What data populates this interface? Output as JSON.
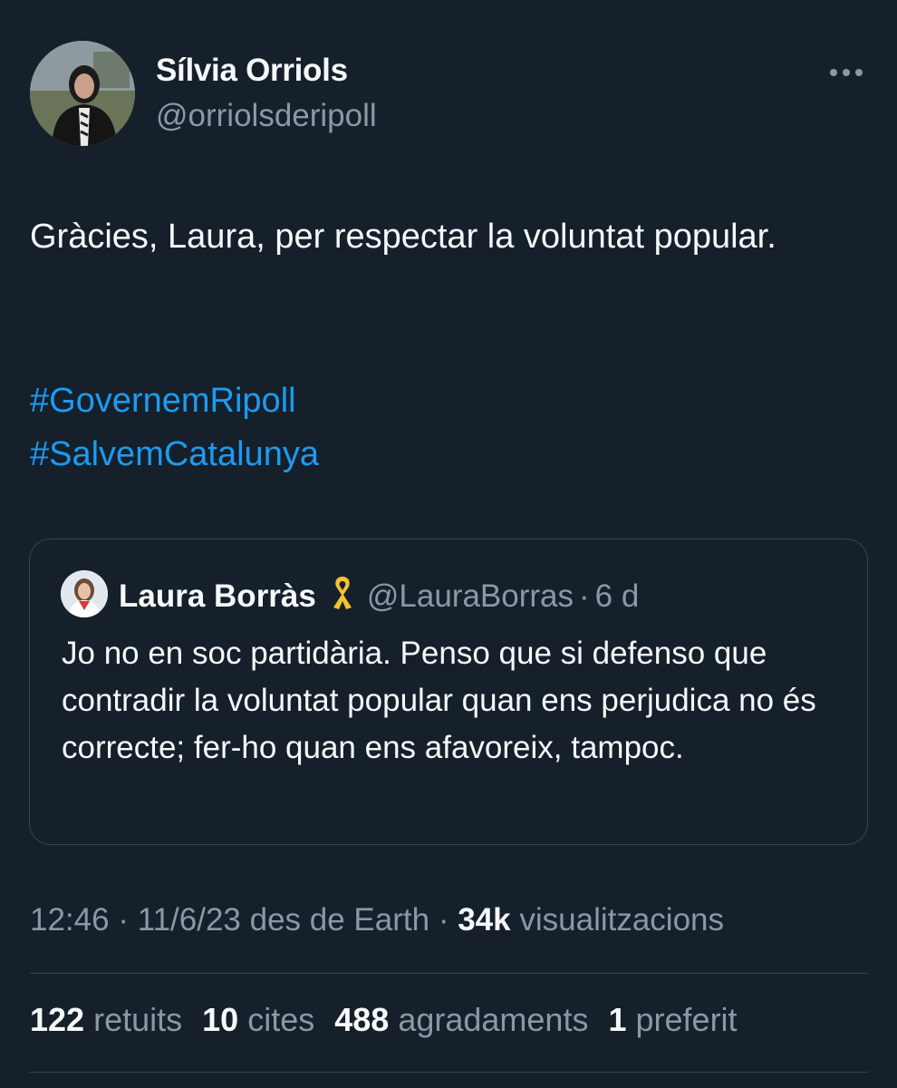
{
  "author": {
    "name": "Sílvia Orriols",
    "handle": "@orriolsderipoll"
  },
  "tweet": {
    "text": "Gràcies, Laura, per respectar la voluntat popular.",
    "hashtags": [
      "#GovernemRipoll",
      "#SalvemCatalunya"
    ]
  },
  "quoted_tweet": {
    "name": "Laura Borràs",
    "name_emoji": "yellow-ribbon-icon",
    "handle": "@LauraBorras",
    "separator": "·",
    "time": "6 d",
    "text": "Jo no en soc partidària. Penso que si defenso que contradir la voluntat popular quan ens perjudica no és correcte; fer-ho quan ens afavoreix, tampoc."
  },
  "meta": {
    "time": "12:46",
    "sep1": "·",
    "date_source": "11/6/23 des de Earth",
    "sep2": "·",
    "views": "34k",
    "views_label": "visualitzacions"
  },
  "stats": {
    "retweets": "122",
    "retweets_label": "retuits",
    "quotes": "10",
    "quotes_label": "cites",
    "likes": "488",
    "likes_label": "agradaments",
    "bookmarks": "1",
    "bookmarks_label": "preferit"
  },
  "colors": {
    "background": "#15202b",
    "text": "#f7f9f9",
    "secondary": "#8b98a5",
    "link": "#1d9bf0",
    "border": "#38444d",
    "ribbon": "#f4c430"
  }
}
